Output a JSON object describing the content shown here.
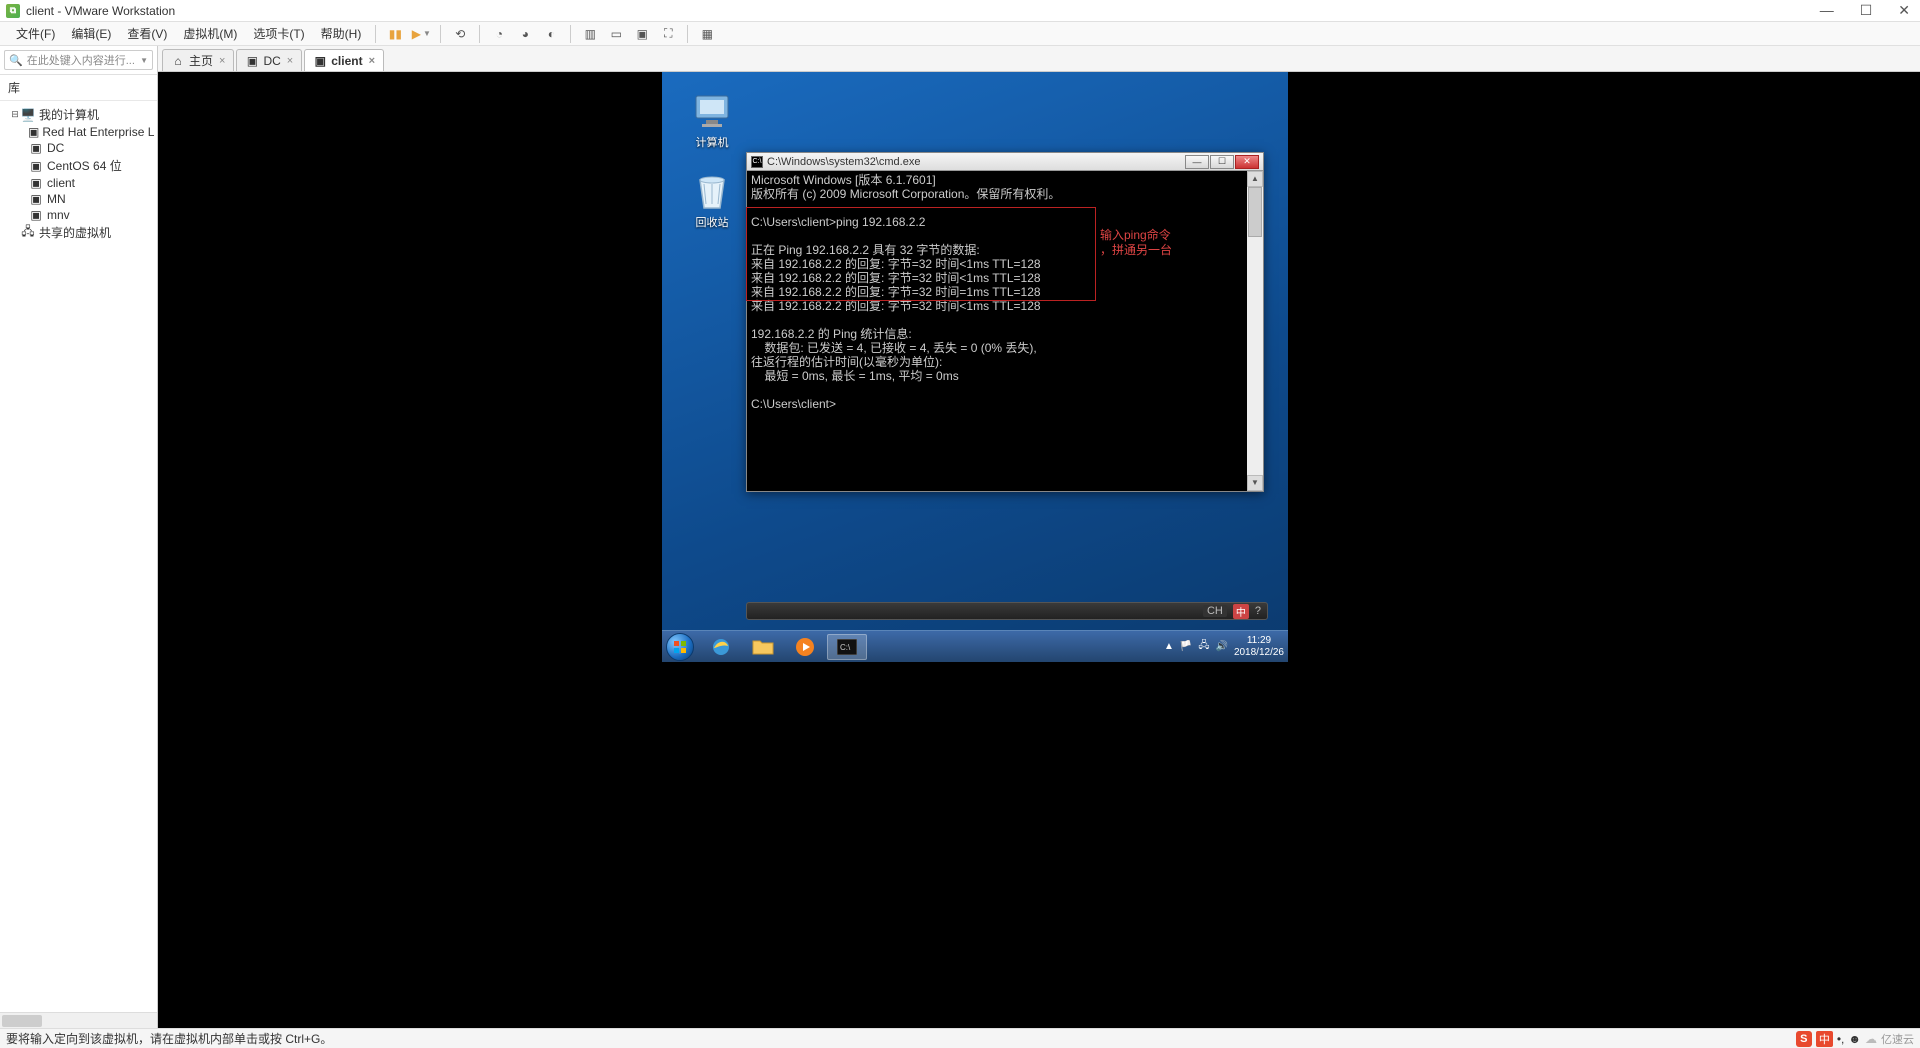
{
  "window": {
    "title": "client - VMware Workstation"
  },
  "menu": {
    "items": [
      "文件(F)",
      "编辑(E)",
      "查看(V)",
      "虚拟机(M)",
      "选项卡(T)",
      "帮助(H)"
    ]
  },
  "sidebar": {
    "search_placeholder": "在此处键入内容进行...",
    "library_label": "库",
    "root": "我的计算机",
    "children": [
      "Red Hat Enterprise L",
      "DC",
      "CentOS 64 位",
      "client",
      "MN",
      "mnv"
    ],
    "shared": "共享的虚拟机"
  },
  "tabs": [
    {
      "label": "主页",
      "icon": "home",
      "active": false
    },
    {
      "label": "DC",
      "icon": "vm",
      "active": false
    },
    {
      "label": "client",
      "icon": "vm",
      "active": true
    }
  ],
  "guest": {
    "desktop_icons": {
      "computer": "计算机",
      "recycle": "回收站"
    },
    "cmd": {
      "title": "C:\\Windows\\system32\\cmd.exe",
      "lines": [
        "Microsoft Windows [版本 6.1.7601]",
        "版权所有 (c) 2009 Microsoft Corporation。保留所有权利。",
        "",
        "C:\\Users\\client>ping 192.168.2.2",
        "",
        "正在 Ping 192.168.2.2 具有 32 字节的数据:",
        "来自 192.168.2.2 的回复: 字节=32 时间<1ms TTL=128",
        "来自 192.168.2.2 的回复: 字节=32 时间<1ms TTL=128",
        "来自 192.168.2.2 的回复: 字节=32 时间=1ms TTL=128",
        "来自 192.168.2.2 的回复: 字节=32 时间<1ms TTL=128",
        "",
        "192.168.2.2 的 Ping 统计信息:",
        "    数据包: 已发送 = 4, 已接收 = 4, 丢失 = 0 (0% 丢失),",
        "往返行程的估计时间(以毫秒为单位):",
        "    最短 = 0ms, 最长 = 1ms, 平均 = 0ms",
        "",
        "C:\\Users\\client>"
      ]
    },
    "annotation": {
      "line1": "输入ping命令",
      "line2": "，拼通另一台"
    },
    "inputbar": {
      "lang": "CH",
      "ime": "中"
    },
    "taskbar": {
      "time": "11:29",
      "date": "2018/12/26"
    }
  },
  "statusbar": {
    "text": "要将输入定向到该虚拟机，请在虚拟机内部单击或按 Ctrl+G。",
    "ime": "中",
    "brand": "亿速云"
  }
}
